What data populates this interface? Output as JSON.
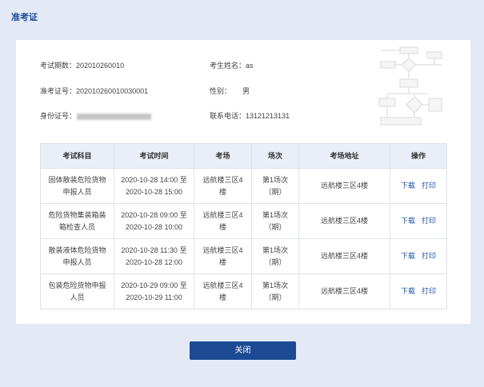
{
  "page": {
    "title": "准考证"
  },
  "info": {
    "exam_period": {
      "label": "考试期数：",
      "value": "202010260010"
    },
    "candidate_name": {
      "label": "考生姓名：",
      "value": "as"
    },
    "ticket_number": {
      "label": "准考证号：",
      "value": "202010260010030001"
    },
    "gender": {
      "label": "性别：",
      "value": "男"
    },
    "id_number": {
      "label": "身份证号："
    },
    "phone": {
      "label": "联系电话：",
      "value": "13121213131"
    }
  },
  "table": {
    "headers": [
      "考试科目",
      "考试时间",
      "考场",
      "场次",
      "考场地址",
      "操作"
    ],
    "rows": [
      {
        "subject": "固体散装危险货物申报人员",
        "time": "2020-10-28 14:00 至 2020-10-28 15:00",
        "room": "远航楼三区4楼",
        "session": "第1场次（期）",
        "address": "远航楼三区4楼",
        "download": "下载",
        "print": "打印"
      },
      {
        "subject": "危险货物集装箱装箱检查人员",
        "time": "2020-10-28 09:00 至 2020-10-28 10:00",
        "room": "远航楼三区4楼",
        "session": "第1场次（期）",
        "address": "远航楼三区4楼",
        "download": "下载",
        "print": "打印"
      },
      {
        "subject": "散装液体危险货物申报人员",
        "time": "2020-10-28 11:30 至 2020-10-28 12:00",
        "room": "远航楼三区4楼",
        "session": "第1场次（期）",
        "address": "远航楼三区4楼",
        "download": "下载",
        "print": "打印"
      },
      {
        "subject": "包装危险货物申报人员",
        "time": "2020-10-29 09:00 至 2020-10-29 11:00",
        "room": "远航楼三区4楼",
        "session": "第1场次（期）",
        "address": "远航楼三区4楼",
        "download": "下载",
        "print": "打印"
      }
    ]
  },
  "footer": {
    "close_label": "关闭"
  },
  "colors": {
    "page_bg": "#e4e9f6",
    "title": "#1e4a97",
    "button_bg": "#1c4a94",
    "link": "#1f4f9c",
    "table_header_bg": "#e9eef8",
    "border": "#dde1ea"
  }
}
